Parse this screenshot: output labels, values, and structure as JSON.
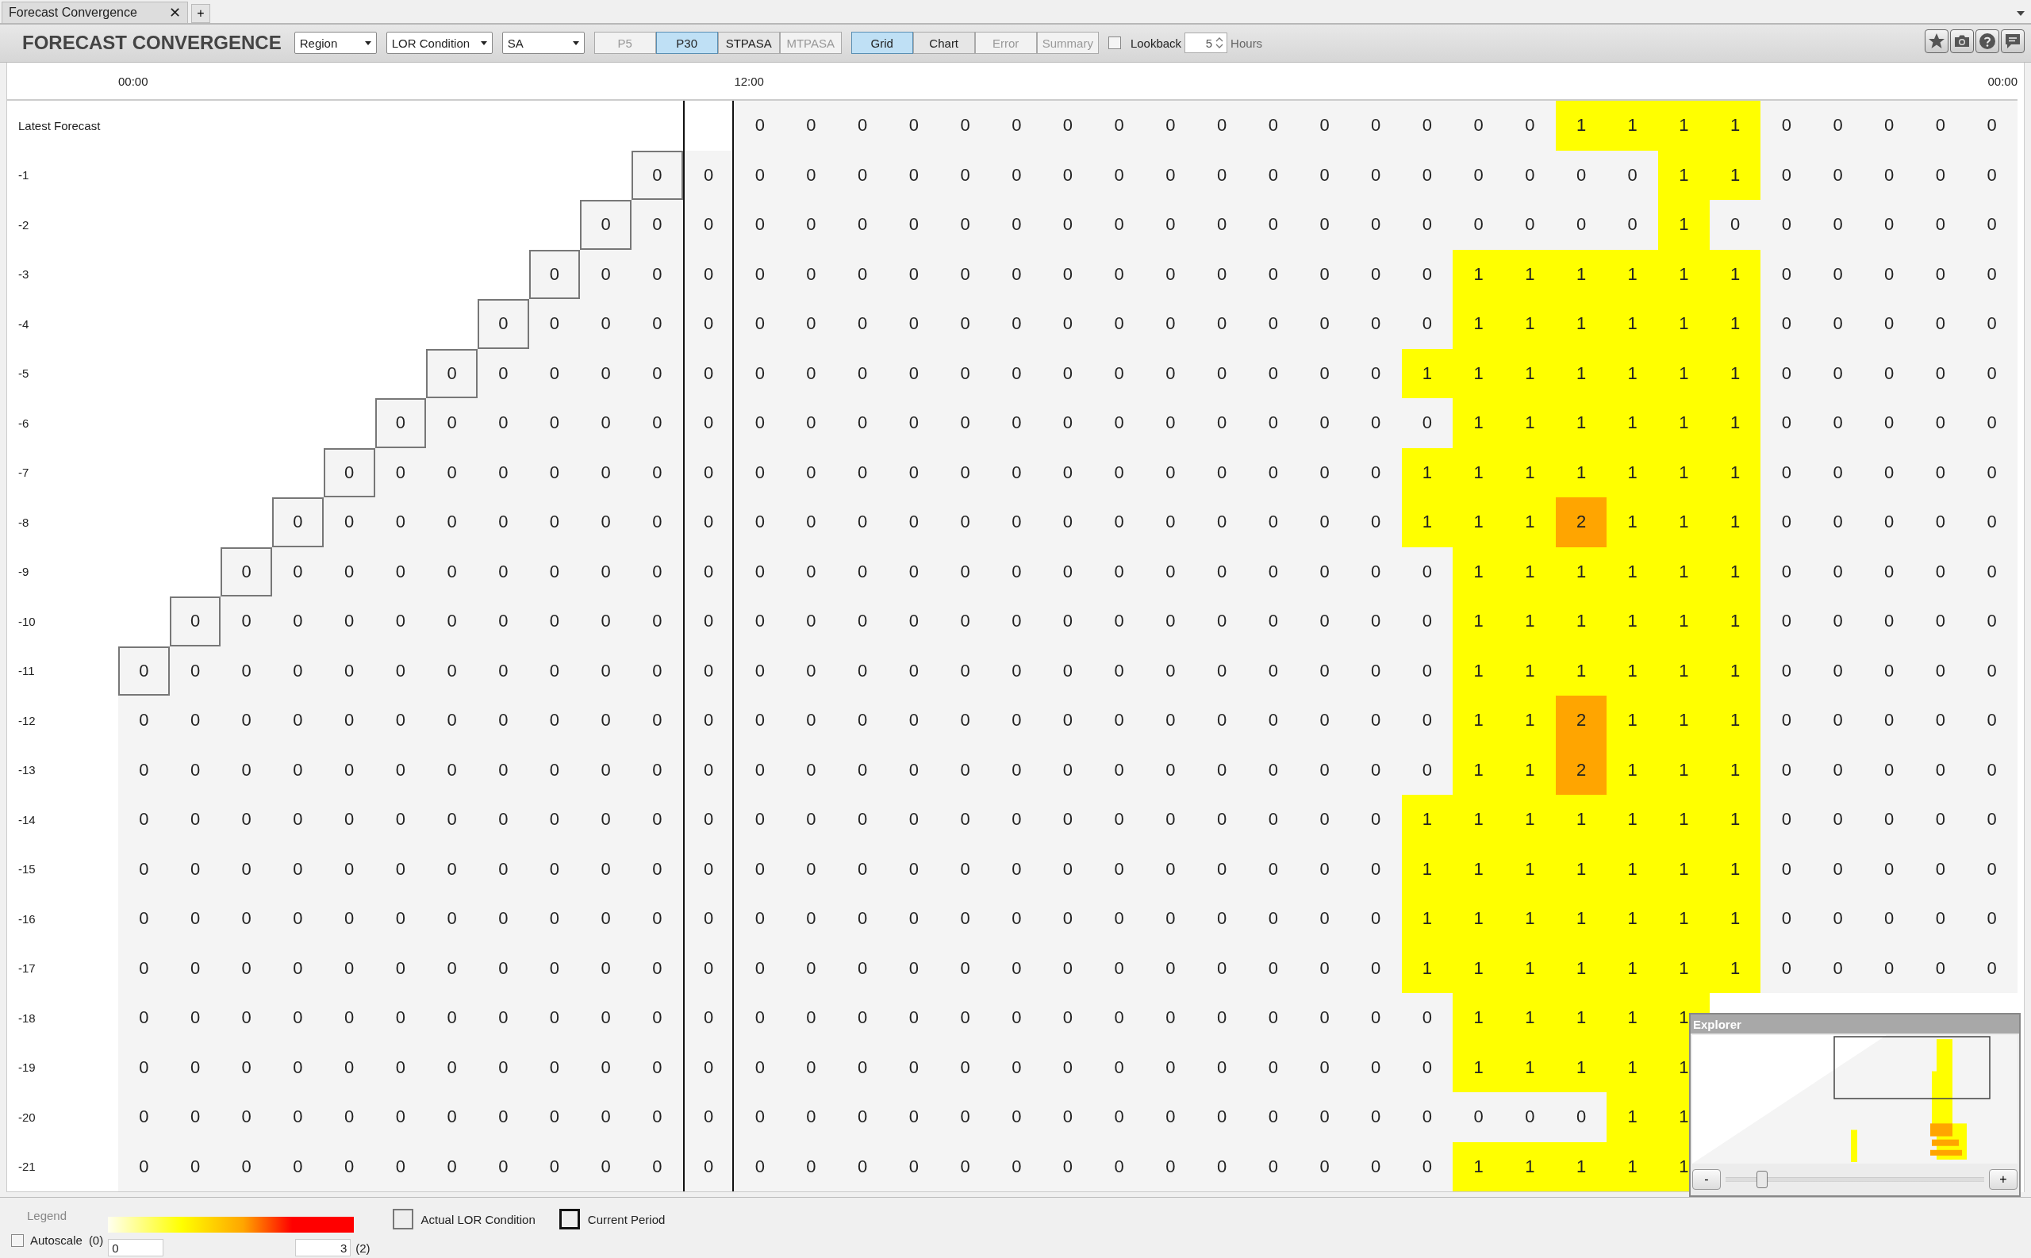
{
  "document_tabs": [
    {
      "label": "Forecast Convergence",
      "close": "✕"
    }
  ],
  "new_tab": "+",
  "toolbar": {
    "title": "FORECAST CONVERGENCE",
    "dropdowns": [
      {
        "value": "Region"
      },
      {
        "value": "LOR Condition"
      },
      {
        "value": "SA"
      }
    ],
    "source_buttons": [
      {
        "label": "P5",
        "selected": false,
        "disabled": true
      },
      {
        "label": "P30",
        "selected": true,
        "disabled": false
      },
      {
        "label": "STPASA",
        "selected": false,
        "disabled": false
      },
      {
        "label": "MTPASA",
        "selected": false,
        "disabled": true
      }
    ],
    "view_buttons": [
      {
        "label": "Grid",
        "selected": true,
        "disabled": false
      },
      {
        "label": "Chart",
        "selected": false,
        "disabled": false
      },
      {
        "label": "Error",
        "selected": false,
        "disabled": true
      },
      {
        "label": "Summary",
        "selected": false,
        "disabled": true
      }
    ],
    "lookback": {
      "label": "Lookback",
      "checked": false,
      "value": "5",
      "unit": "Hours"
    }
  },
  "columns": [
    {
      "time": "00:00",
      "current": false
    },
    {
      "current": false
    },
    {
      "current": false
    },
    {
      "current": false
    },
    {
      "current": false
    },
    {
      "current": false
    },
    {
      "current": false
    },
    {
      "current": false
    },
    {
      "current": false
    },
    {
      "current": false
    },
    {
      "current": false
    },
    {
      "current": true
    },
    {
      "time": "12:00",
      "current": false
    },
    {
      "current": false
    },
    {
      "current": false
    },
    {
      "current": false
    },
    {
      "current": false
    },
    {
      "current": false
    },
    {
      "current": false
    },
    {
      "current": false
    },
    {
      "current": false
    },
    {
      "current": false
    },
    {
      "current": false
    },
    {
      "current": false
    },
    {
      "current": false
    },
    {
      "current": false
    },
    {
      "current": false
    },
    {
      "current": false
    },
    {
      "current": false
    },
    {
      "current": false
    },
    {
      "current": false
    },
    {
      "current": false
    },
    {
      "current": false
    },
    {
      "current": false
    },
    {
      "current": false
    },
    {
      "current": false
    },
    {
      "time": "00:00",
      "current": false
    }
  ],
  "rows": [
    {
      "label": "Latest Forecast",
      "actual_marked": false,
      "cells": [
        null,
        null,
        null,
        null,
        null,
        null,
        null,
        null,
        null,
        null,
        null,
        null,
        "0",
        "0",
        "0",
        "0",
        "0",
        "0",
        "0",
        "0",
        "0",
        "0",
        "0",
        "0",
        "0",
        "0",
        "0",
        "0",
        "1",
        "1",
        "1",
        "1",
        "0",
        "0",
        "0",
        "0",
        "0"
      ]
    },
    {
      "label": "-1",
      "actual_marked": true,
      "cells": [
        null,
        null,
        null,
        null,
        null,
        null,
        null,
        null,
        null,
        null,
        "0",
        "0",
        "0",
        "0",
        "0",
        "0",
        "0",
        "0",
        "0",
        "0",
        "0",
        "0",
        "0",
        "0",
        "0",
        "0",
        "0",
        "0",
        "0",
        "0",
        "1",
        "1",
        "0",
        "0",
        "0",
        "0",
        "0"
      ]
    },
    {
      "label": "-2",
      "actual_marked": true,
      "cells": [
        null,
        null,
        null,
        null,
        null,
        null,
        null,
        null,
        null,
        "0",
        "0",
        "0",
        "0",
        "0",
        "0",
        "0",
        "0",
        "0",
        "0",
        "0",
        "0",
        "0",
        "0",
        "0",
        "0",
        "0",
        "0",
        "0",
        "0",
        "0",
        "1",
        "0",
        "0",
        "0",
        "0",
        "0",
        "0"
      ]
    },
    {
      "label": "-3",
      "actual_marked": true,
      "cells": [
        null,
        null,
        null,
        null,
        null,
        null,
        null,
        null,
        "0",
        "0",
        "0",
        "0",
        "0",
        "0",
        "0",
        "0",
        "0",
        "0",
        "0",
        "0",
        "0",
        "0",
        "0",
        "0",
        "0",
        "0",
        "1",
        "1",
        "1",
        "1",
        "1",
        "1",
        "0",
        "0",
        "0",
        "0",
        "0"
      ]
    },
    {
      "label": "-4",
      "actual_marked": true,
      "cells": [
        null,
        null,
        null,
        null,
        null,
        null,
        null,
        "0",
        "0",
        "0",
        "0",
        "0",
        "0",
        "0",
        "0",
        "0",
        "0",
        "0",
        "0",
        "0",
        "0",
        "0",
        "0",
        "0",
        "0",
        "0",
        "1",
        "1",
        "1",
        "1",
        "1",
        "1",
        "0",
        "0",
        "0",
        "0",
        "0"
      ]
    },
    {
      "label": "-5",
      "actual_marked": true,
      "cells": [
        null,
        null,
        null,
        null,
        null,
        null,
        "0",
        "0",
        "0",
        "0",
        "0",
        "0",
        "0",
        "0",
        "0",
        "0",
        "0",
        "0",
        "0",
        "0",
        "0",
        "0",
        "0",
        "0",
        "0",
        "1",
        "1",
        "1",
        "1",
        "1",
        "1",
        "1",
        "0",
        "0",
        "0",
        "0",
        "0"
      ]
    },
    {
      "label": "-6",
      "actual_marked": true,
      "cells": [
        null,
        null,
        null,
        null,
        null,
        "0",
        "0",
        "0",
        "0",
        "0",
        "0",
        "0",
        "0",
        "0",
        "0",
        "0",
        "0",
        "0",
        "0",
        "0",
        "0",
        "0",
        "0",
        "0",
        "0",
        "0",
        "1",
        "1",
        "1",
        "1",
        "1",
        "1",
        "0",
        "0",
        "0",
        "0",
        "0"
      ]
    },
    {
      "label": "-7",
      "actual_marked": true,
      "cells": [
        null,
        null,
        null,
        null,
        "0",
        "0",
        "0",
        "0",
        "0",
        "0",
        "0",
        "0",
        "0",
        "0",
        "0",
        "0",
        "0",
        "0",
        "0",
        "0",
        "0",
        "0",
        "0",
        "0",
        "0",
        "1",
        "1",
        "1",
        "1",
        "1",
        "1",
        "1",
        "0",
        "0",
        "0",
        "0",
        "0"
      ]
    },
    {
      "label": "-8",
      "actual_marked": true,
      "cells": [
        null,
        null,
        null,
        "0",
        "0",
        "0",
        "0",
        "0",
        "0",
        "0",
        "0",
        "0",
        "0",
        "0",
        "0",
        "0",
        "0",
        "0",
        "0",
        "0",
        "0",
        "0",
        "0",
        "0",
        "0",
        "1",
        "1",
        "1",
        "2",
        "1",
        "1",
        "1",
        "0",
        "0",
        "0",
        "0",
        "0"
      ]
    },
    {
      "label": "-9",
      "actual_marked": true,
      "cells": [
        null,
        null,
        "0",
        "0",
        "0",
        "0",
        "0",
        "0",
        "0",
        "0",
        "0",
        "0",
        "0",
        "0",
        "0",
        "0",
        "0",
        "0",
        "0",
        "0",
        "0",
        "0",
        "0",
        "0",
        "0",
        "0",
        "1",
        "1",
        "1",
        "1",
        "1",
        "1",
        "0",
        "0",
        "0",
        "0",
        "0"
      ]
    },
    {
      "label": "-10",
      "actual_marked": true,
      "cells": [
        null,
        "0",
        "0",
        "0",
        "0",
        "0",
        "0",
        "0",
        "0",
        "0",
        "0",
        "0",
        "0",
        "0",
        "0",
        "0",
        "0",
        "0",
        "0",
        "0",
        "0",
        "0",
        "0",
        "0",
        "0",
        "0",
        "1",
        "1",
        "1",
        "1",
        "1",
        "1",
        "0",
        "0",
        "0",
        "0",
        "0"
      ]
    },
    {
      "label": "-11",
      "actual_marked": true,
      "cells": [
        "0",
        "0",
        "0",
        "0",
        "0",
        "0",
        "0",
        "0",
        "0",
        "0",
        "0",
        "0",
        "0",
        "0",
        "0",
        "0",
        "0",
        "0",
        "0",
        "0",
        "0",
        "0",
        "0",
        "0",
        "0",
        "0",
        "1",
        "1",
        "1",
        "1",
        "1",
        "1",
        "0",
        "0",
        "0",
        "0",
        "0"
      ]
    },
    {
      "label": "-12",
      "actual_marked": false,
      "cells": [
        "0",
        "0",
        "0",
        "0",
        "0",
        "0",
        "0",
        "0",
        "0",
        "0",
        "0",
        "0",
        "0",
        "0",
        "0",
        "0",
        "0",
        "0",
        "0",
        "0",
        "0",
        "0",
        "0",
        "0",
        "0",
        "0",
        "1",
        "1",
        "2",
        "1",
        "1",
        "1",
        "0",
        "0",
        "0",
        "0",
        "0"
      ]
    },
    {
      "label": "-13",
      "actual_marked": false,
      "cells": [
        "0",
        "0",
        "0",
        "0",
        "0",
        "0",
        "0",
        "0",
        "0",
        "0",
        "0",
        "0",
        "0",
        "0",
        "0",
        "0",
        "0",
        "0",
        "0",
        "0",
        "0",
        "0",
        "0",
        "0",
        "0",
        "0",
        "1",
        "1",
        "2",
        "1",
        "1",
        "1",
        "0",
        "0",
        "0",
        "0",
        "0"
      ]
    },
    {
      "label": "-14",
      "actual_marked": false,
      "cells": [
        "0",
        "0",
        "0",
        "0",
        "0",
        "0",
        "0",
        "0",
        "0",
        "0",
        "0",
        "0",
        "0",
        "0",
        "0",
        "0",
        "0",
        "0",
        "0",
        "0",
        "0",
        "0",
        "0",
        "0",
        "0",
        "1",
        "1",
        "1",
        "1",
        "1",
        "1",
        "1",
        "0",
        "0",
        "0",
        "0",
        "0"
      ]
    },
    {
      "label": "-15",
      "actual_marked": false,
      "cells": [
        "0",
        "0",
        "0",
        "0",
        "0",
        "0",
        "0",
        "0",
        "0",
        "0",
        "0",
        "0",
        "0",
        "0",
        "0",
        "0",
        "0",
        "0",
        "0",
        "0",
        "0",
        "0",
        "0",
        "0",
        "0",
        "1",
        "1",
        "1",
        "1",
        "1",
        "1",
        "1",
        "0",
        "0",
        "0",
        "0",
        "0"
      ]
    },
    {
      "label": "-16",
      "actual_marked": false,
      "cells": [
        "0",
        "0",
        "0",
        "0",
        "0",
        "0",
        "0",
        "0",
        "0",
        "0",
        "0",
        "0",
        "0",
        "0",
        "0",
        "0",
        "0",
        "0",
        "0",
        "0",
        "0",
        "0",
        "0",
        "0",
        "0",
        "1",
        "1",
        "1",
        "1",
        "1",
        "1",
        "1",
        "0",
        "0",
        "0",
        "0",
        "0"
      ]
    },
    {
      "label": "-17",
      "actual_marked": false,
      "cells": [
        "0",
        "0",
        "0",
        "0",
        "0",
        "0",
        "0",
        "0",
        "0",
        "0",
        "0",
        "0",
        "0",
        "0",
        "0",
        "0",
        "0",
        "0",
        "0",
        "0",
        "0",
        "0",
        "0",
        "0",
        "0",
        "1",
        "1",
        "1",
        "1",
        "1",
        "1",
        "1",
        "0",
        "0",
        "0",
        "0",
        "0"
      ]
    },
    {
      "label": "-18",
      "actual_marked": false,
      "cells": [
        "0",
        "0",
        "0",
        "0",
        "0",
        "0",
        "0",
        "0",
        "0",
        "0",
        "0",
        "0",
        "0",
        "0",
        "0",
        "0",
        "0",
        "0",
        "0",
        "0",
        "0",
        "0",
        "0",
        "0",
        "0",
        "0",
        "1",
        "1",
        "1",
        "1",
        "1"
      ]
    },
    {
      "label": "-19",
      "actual_marked": false,
      "cells": [
        "0",
        "0",
        "0",
        "0",
        "0",
        "0",
        "0",
        "0",
        "0",
        "0",
        "0",
        "0",
        "0",
        "0",
        "0",
        "0",
        "0",
        "0",
        "0",
        "0",
        "0",
        "0",
        "0",
        "0",
        "0",
        "0",
        "1",
        "1",
        "1",
        "1",
        "1"
      ]
    },
    {
      "label": "-20",
      "actual_marked": false,
      "cells": [
        "0",
        "0",
        "0",
        "0",
        "0",
        "0",
        "0",
        "0",
        "0",
        "0",
        "0",
        "0",
        "0",
        "0",
        "0",
        "0",
        "0",
        "0",
        "0",
        "0",
        "0",
        "0",
        "0",
        "0",
        "0",
        "0",
        "0",
        "0",
        "0",
        "1",
        "1"
      ]
    },
    {
      "label": "-21",
      "actual_marked": false,
      "cells": [
        "0",
        "0",
        "0",
        "0",
        "0",
        "0",
        "0",
        "0",
        "0",
        "0",
        "0",
        "0",
        "0",
        "0",
        "0",
        "0",
        "0",
        "0",
        "0",
        "0",
        "0",
        "0",
        "0",
        "0",
        "0",
        "0",
        "1",
        "1",
        "1",
        "1",
        "1"
      ]
    }
  ],
  "explorer": {
    "title": "Explorer",
    "zoom_out": "-",
    "zoom_in": "+",
    "zoom": {
      "level": 0.12
    }
  },
  "legend": {
    "title": "Legend",
    "autoscale": {
      "label": "Autoscale",
      "checked": false
    },
    "min_hint": "(0)",
    "min": "0",
    "max": "3",
    "max_hint": "(2)",
    "actual_label": "Actual LOR Condition",
    "current_label": "Current Period"
  }
}
